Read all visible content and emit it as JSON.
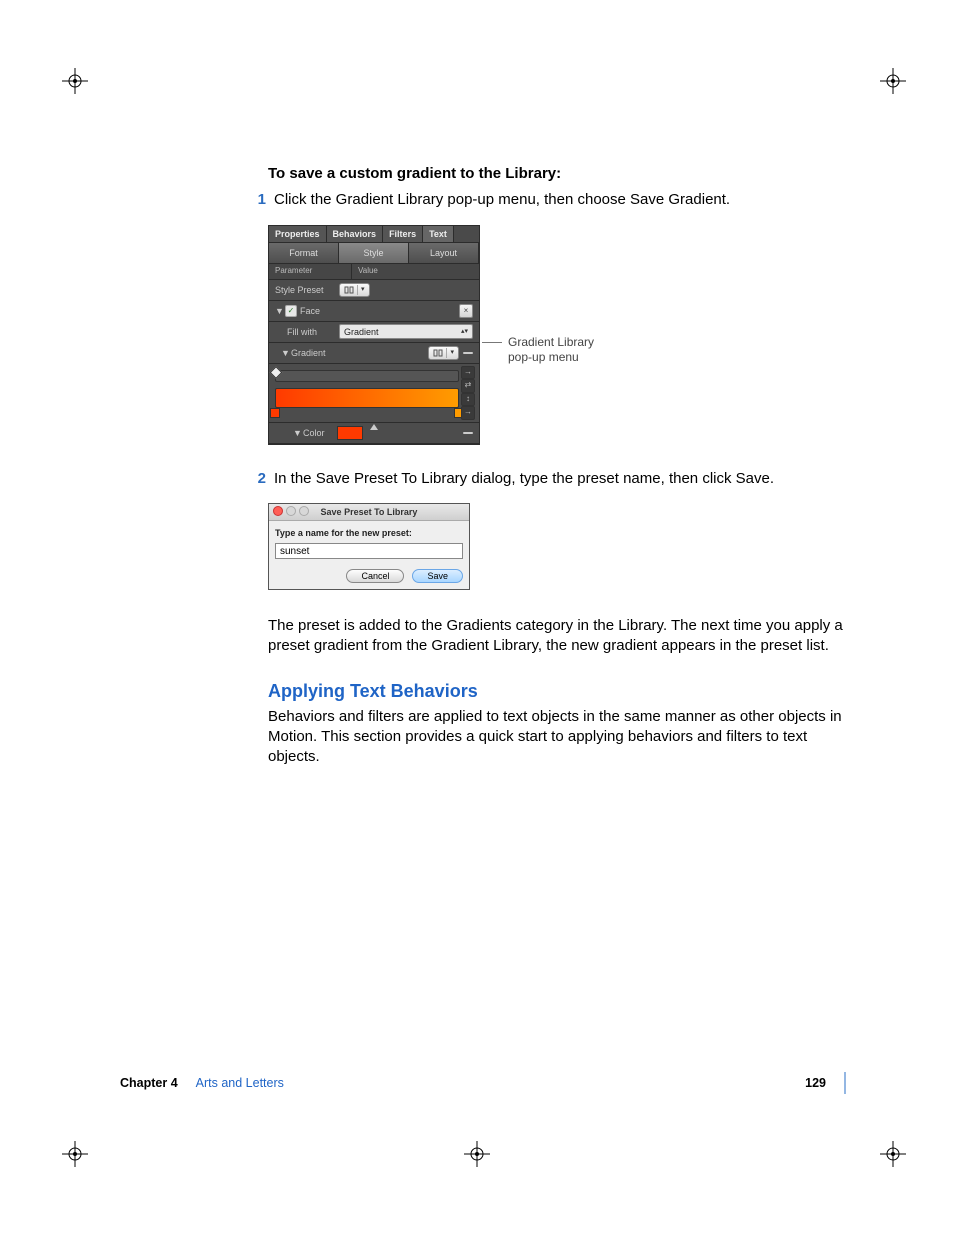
{
  "content": {
    "lead_heading": "To save a custom gradient to the Library:",
    "step1_num": "1",
    "step1_text": "Click the Gradient Library pop-up menu, then choose Save Gradient.",
    "step2_num": "2",
    "step2_text": "In the Save Preset To Library dialog, type the preset name, then click Save.",
    "after_dialog_p": "The preset is added to the Gradients category in the Library. The next time you apply a preset gradient from the Gradient Library, the new gradient appears in the preset list.",
    "section_title": "Applying Text Behaviors",
    "section_body": "Behaviors and filters are applied to text objects in the same manner as other objects in Motion. This section provides a quick start to applying behaviors and filters to text objects."
  },
  "inspector": {
    "tabs": [
      "Properties",
      "Behaviors",
      "Filters",
      "Text"
    ],
    "active_tab": "Text",
    "subtabs": [
      "Format",
      "Style",
      "Layout"
    ],
    "active_subtab": "Style",
    "col_param": "Parameter",
    "col_value": "Value",
    "rows": {
      "style_preset": "Style Preset",
      "face": "Face",
      "fill_with": "Fill with",
      "fill_value": "Gradient",
      "gradient": "Gradient",
      "color": "Color"
    },
    "callout": "Gradient Library pop-up menu"
  },
  "dialog": {
    "title": "Save Preset To Library",
    "prompt": "Type a name for the new preset:",
    "value": "sunset",
    "cancel": "Cancel",
    "save": "Save"
  },
  "footer": {
    "chapter_label": "Chapter 4",
    "chapter_name": "Arts and Letters",
    "page": "129"
  }
}
